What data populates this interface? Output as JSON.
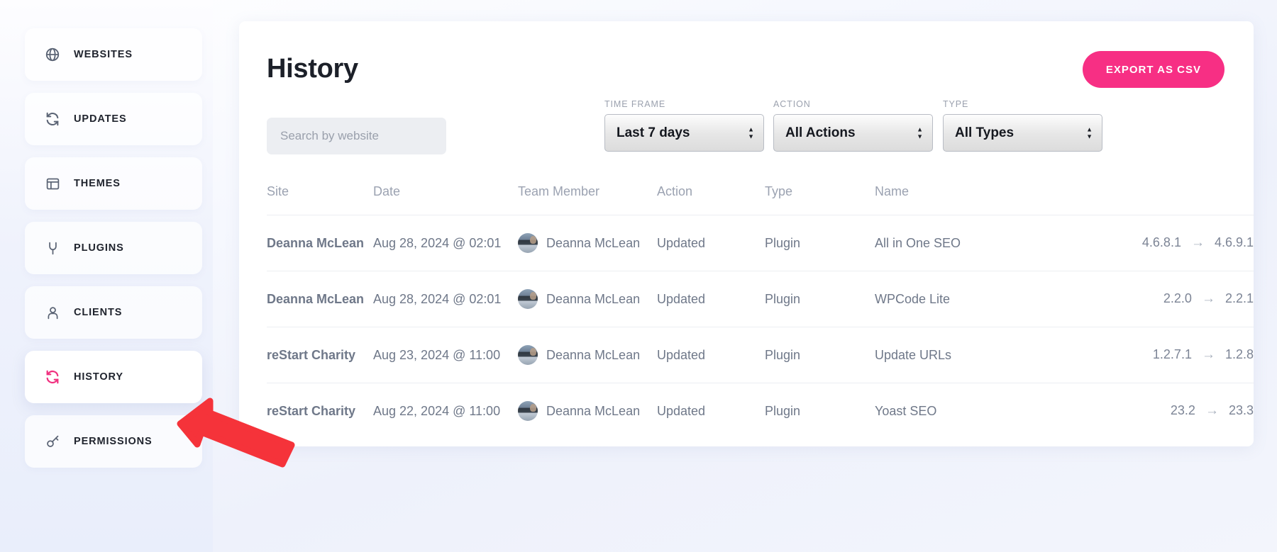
{
  "sidebar": {
    "items": [
      {
        "label": "WEBSITES",
        "icon": "globe-icon",
        "active": false
      },
      {
        "label": "UPDATES",
        "icon": "refresh-icon",
        "active": false
      },
      {
        "label": "THEMES",
        "icon": "window-icon",
        "active": false
      },
      {
        "label": "PLUGINS",
        "icon": "plug-icon",
        "active": false
      },
      {
        "label": "CLIENTS",
        "icon": "user-icon",
        "active": false
      },
      {
        "label": "HISTORY",
        "icon": "refresh-icon",
        "active": true
      },
      {
        "label": "PERMISSIONS",
        "icon": "key-icon",
        "active": false
      }
    ]
  },
  "header": {
    "title": "History",
    "export_label": "EXPORT AS CSV"
  },
  "search": {
    "placeholder": "Search by website",
    "value": ""
  },
  "filters": [
    {
      "label": "TIME FRAME",
      "value": "Last 7 days",
      "options": [
        "Last 7 days"
      ]
    },
    {
      "label": "ACTION",
      "value": "All Actions",
      "options": [
        "All Actions"
      ]
    },
    {
      "label": "TYPE",
      "value": "All Types",
      "options": [
        "All Types"
      ]
    }
  ],
  "table": {
    "columns": [
      "Site",
      "Date",
      "Team Member",
      "Action",
      "Type",
      "Name",
      ""
    ],
    "rows": [
      {
        "site": "Deanna McLean",
        "date": "Aug 28, 2024 @ 02:01",
        "member": "Deanna McLean",
        "action": "Updated",
        "type": "Plugin",
        "name": "All in One SEO",
        "version_from": "4.6.8.1",
        "version_to": "4.6.9.1"
      },
      {
        "site": "Deanna McLean",
        "date": "Aug 28, 2024 @ 02:01",
        "member": "Deanna McLean",
        "action": "Updated",
        "type": "Plugin",
        "name": "WPCode Lite",
        "version_from": "2.2.0",
        "version_to": "2.2.1"
      },
      {
        "site": "reStart Charity",
        "date": "Aug 23, 2024 @ 11:00",
        "member": "Deanna McLean",
        "action": "Updated",
        "type": "Plugin",
        "name": "Update URLs",
        "version_from": "1.2.7.1",
        "version_to": "1.2.8"
      },
      {
        "site": "reStart Charity",
        "date": "Aug 22, 2024 @ 11:00",
        "member": "Deanna McLean",
        "action": "Updated",
        "type": "Plugin",
        "name": "Yoast SEO",
        "version_from": "23.2",
        "version_to": "23.3"
      }
    ],
    "version_arrow": "→"
  },
  "annotation": {
    "shape": "arrow-pointing-left",
    "color": "#f5333a",
    "points_to": "HISTORY"
  },
  "colors": {
    "accent": "#f72f84",
    "annotation": "#f5333a",
    "sidebar_bg": "#eef1fb",
    "card_bg": "#ffffff",
    "text_dark": "#20242e",
    "text_muted": "#9ba2b1"
  }
}
